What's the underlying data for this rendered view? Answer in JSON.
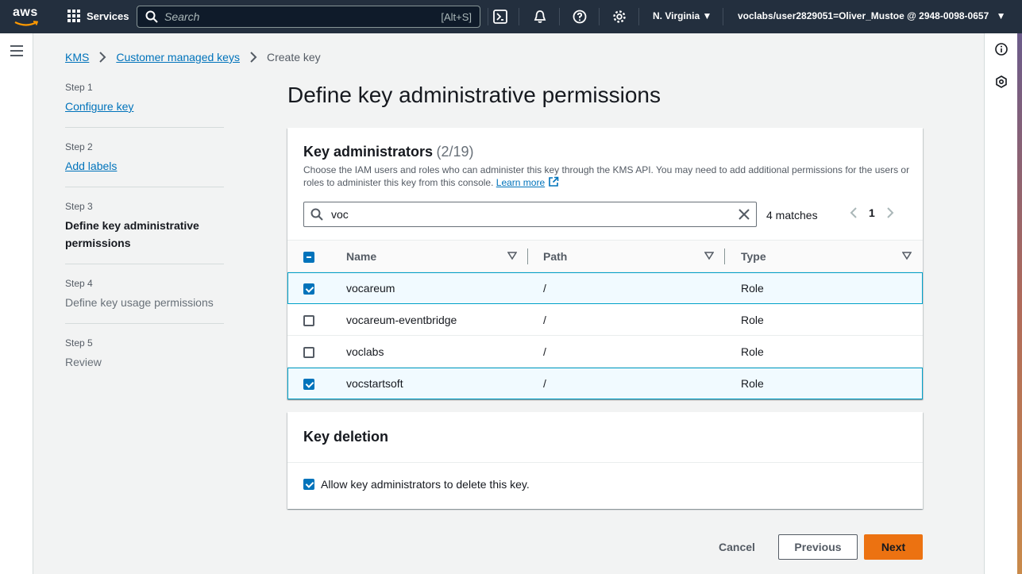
{
  "topnav": {
    "logo_text": "aws",
    "services_label": "Services",
    "search_placeholder": "Search",
    "search_shortcut": "[Alt+S]",
    "region": "N. Virginia",
    "account": "voclabs/user2829051=Oliver_Mustoe @ 2948-0098-0657"
  },
  "breadcrumb": {
    "items": [
      "KMS",
      "Customer managed keys",
      "Create key"
    ]
  },
  "steps": [
    {
      "num": "Step 1",
      "label": "Configure key"
    },
    {
      "num": "Step 2",
      "label": "Add labels"
    },
    {
      "num": "Step 3",
      "label": "Define key administrative permissions"
    },
    {
      "num": "Step 4",
      "label": "Define key usage permissions"
    },
    {
      "num": "Step 5",
      "label": "Review"
    }
  ],
  "page_title": "Define key administrative permissions",
  "key_admins": {
    "title": "Key administrators",
    "count": "(2/19)",
    "description": "Choose the IAM users and roles who can administer this key through the KMS API. You may need to add additional permissions for the users or roles to administer this key from this console.",
    "learn_more": "Learn more",
    "filter_value": "voc",
    "matches": "4 matches",
    "page": "1",
    "columns": [
      "Name",
      "Path",
      "Type"
    ],
    "rows": [
      {
        "name": "vocareum",
        "path": "/",
        "type": "Role",
        "selected": true
      },
      {
        "name": "vocareum-eventbridge",
        "path": "/",
        "type": "Role",
        "selected": false
      },
      {
        "name": "voclabs",
        "path": "/",
        "type": "Role",
        "selected": false
      },
      {
        "name": "vocstartsoft",
        "path": "/",
        "type": "Role",
        "selected": true
      }
    ]
  },
  "key_deletion": {
    "title": "Key deletion",
    "option_label": "Allow key administrators to delete this key."
  },
  "buttons": {
    "cancel": "Cancel",
    "previous": "Previous",
    "next": "Next"
  },
  "colors": {
    "nav_bg": "#232f3e",
    "link": "#0073bb",
    "primary_button": "#ec7211",
    "selected_row_border": "#00a1c9"
  }
}
